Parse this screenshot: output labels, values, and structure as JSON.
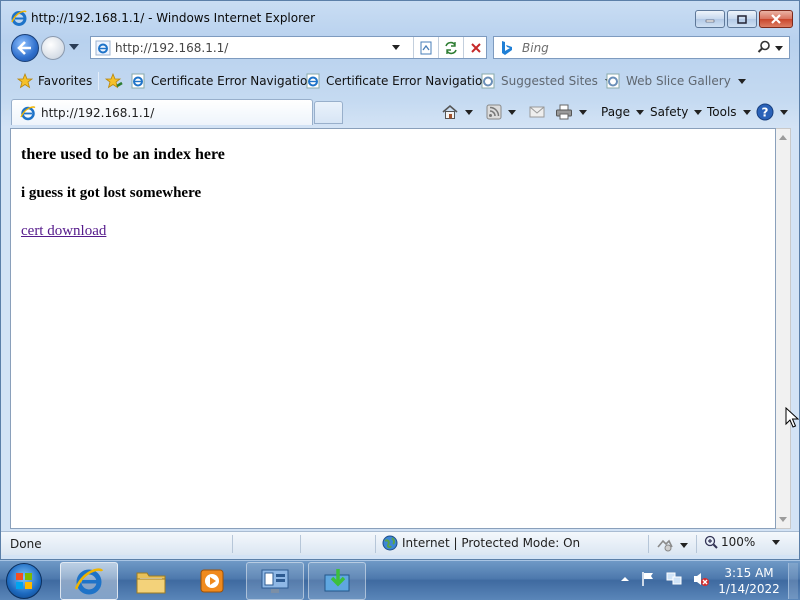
{
  "window": {
    "title": "http://192.168.1.1/ - Windows Internet Explorer"
  },
  "nav": {
    "address_url": "http://192.168.1.1/",
    "search_placeholder": "Bing"
  },
  "favorites_bar": {
    "favorites_label": "Favorites",
    "items": [
      {
        "label": "Certificate Error Navigatio..."
      },
      {
        "label": "Certificate Error Navigatio..."
      },
      {
        "label": "Suggested Sites"
      },
      {
        "label": "Web Slice Gallery"
      }
    ]
  },
  "tabs": [
    {
      "label": "http://192.168.1.1/"
    }
  ],
  "command_bar": {
    "page_label": "Page",
    "safety_label": "Safety",
    "tools_label": "Tools"
  },
  "page": {
    "heading1": "there used to be an index here",
    "heading2": "i guess it got lost somewhere",
    "link_text": "cert download"
  },
  "status_bar": {
    "status_text": "Done",
    "zone_text": "Internet | Protected Mode: On",
    "zoom_text": "100%"
  },
  "taskbar": {
    "time": "3:15 AM",
    "date": "1/14/2022"
  },
  "colors": {
    "link_visited": "#551a8b",
    "taskbar": "#4d79ad",
    "chrome": "#c9ddf3"
  }
}
